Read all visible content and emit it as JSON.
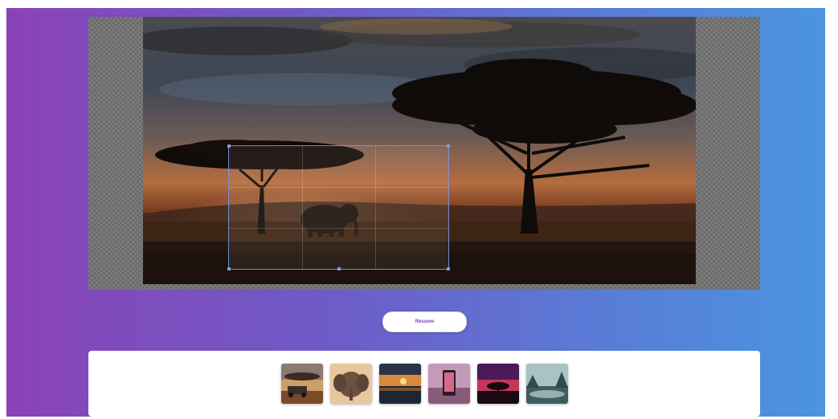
{
  "editor": {
    "photo_subject": "elephant-savanna-sunset",
    "crop": {
      "active": true
    }
  },
  "controls": {
    "resume_label": "Resume"
  },
  "tray": {
    "thumbnails": [
      {
        "name": "thumb-jeep-savanna",
        "selected": false
      },
      {
        "name": "thumb-elephant",
        "selected": false
      },
      {
        "name": "thumb-sunset-lake",
        "selected": false
      },
      {
        "name": "thumb-phone-pink",
        "selected": false
      },
      {
        "name": "thumb-tree-purple-sky",
        "selected": false
      },
      {
        "name": "thumb-misty-forest",
        "selected": false
      }
    ]
  },
  "colors": {
    "gradient_left": "#8a42b7",
    "gradient_right": "#4a96df",
    "accent": "#7a3fc0"
  }
}
